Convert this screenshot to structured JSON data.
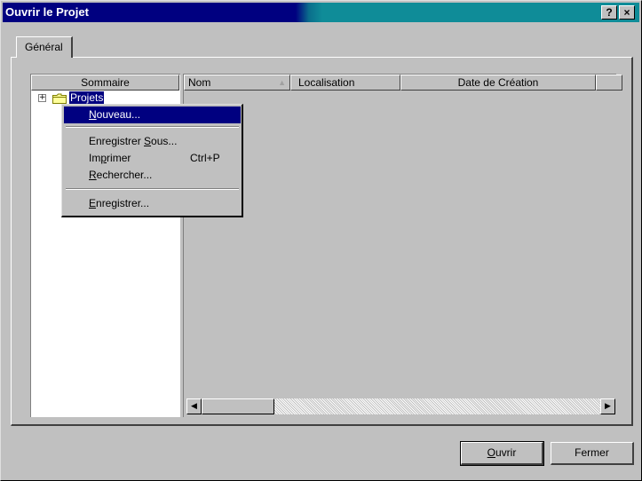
{
  "window": {
    "title": "Ouvrir le Projet",
    "help_label": "?",
    "close_label": "×"
  },
  "tabs": [
    {
      "label": "Général",
      "selected": true
    }
  ],
  "tree": {
    "header": "Sommaire",
    "items": [
      {
        "label": "Projets",
        "expander": "+",
        "selected": true,
        "icon": "folder-icon"
      }
    ]
  },
  "list": {
    "columns": [
      {
        "label": "Nom",
        "sort_indicator": "▲"
      },
      {
        "label": "Localisation"
      },
      {
        "label": "Date de Création"
      },
      {
        "label": ""
      }
    ],
    "rows": []
  },
  "context_menu": {
    "items": [
      {
        "label": "Nouveau...",
        "mnemonic_index": 0,
        "selected": true
      },
      {
        "separator": true
      },
      {
        "label": "Enregistrer Sous...",
        "mnemonic_index": 12
      },
      {
        "label": "Imprimer",
        "shortcut": "Ctrl+P",
        "mnemonic_index": 2
      },
      {
        "label": "Rechercher...",
        "mnemonic_index": 0
      },
      {
        "separator": true
      },
      {
        "label": "Enregistrer...",
        "mnemonic_index": 0
      }
    ]
  },
  "buttons": {
    "open": "Ouvrir",
    "close": "Fermer"
  },
  "colors": {
    "title_active": "#000080",
    "selection": "#000080",
    "face": "#c0c0c0"
  }
}
